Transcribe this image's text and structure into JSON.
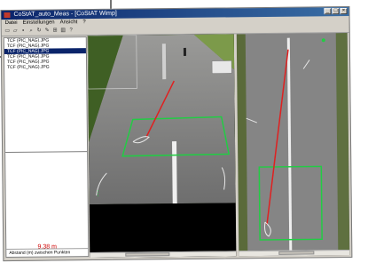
{
  "window": {
    "title": "CoStAT_auto_Meas - [CoStAT Wimp]",
    "controls": [
      "_",
      "□",
      "×"
    ]
  },
  "menu": [
    "Datei",
    "Einstellungen",
    "Ansicht",
    "?"
  ],
  "toolbar": [
    "new-icon",
    "open-icon",
    "save-icon",
    "zoom-icon",
    "rotate-icon",
    "draw-icon",
    "measure-icon",
    "grid-icon",
    "help-icon"
  ],
  "file_list": {
    "items": [
      "TCF (PIC_NAG).JPG",
      "TCF (PIC_NAG).JPG",
      "TCF (PIC_NAG).JPG",
      "TCF (PIC_NAG).JPG",
      "TCF (PIC_NAG).JPG",
      "TCF (PIC_NAG).JPG"
    ],
    "selected_index": 2
  },
  "measurement": "9.38 m",
  "status": "Abstand (m) zwischen Punkten",
  "colors": {
    "measure_line": "#e02020",
    "grid": "#22cc44",
    "measurement_text": "#d00000"
  }
}
